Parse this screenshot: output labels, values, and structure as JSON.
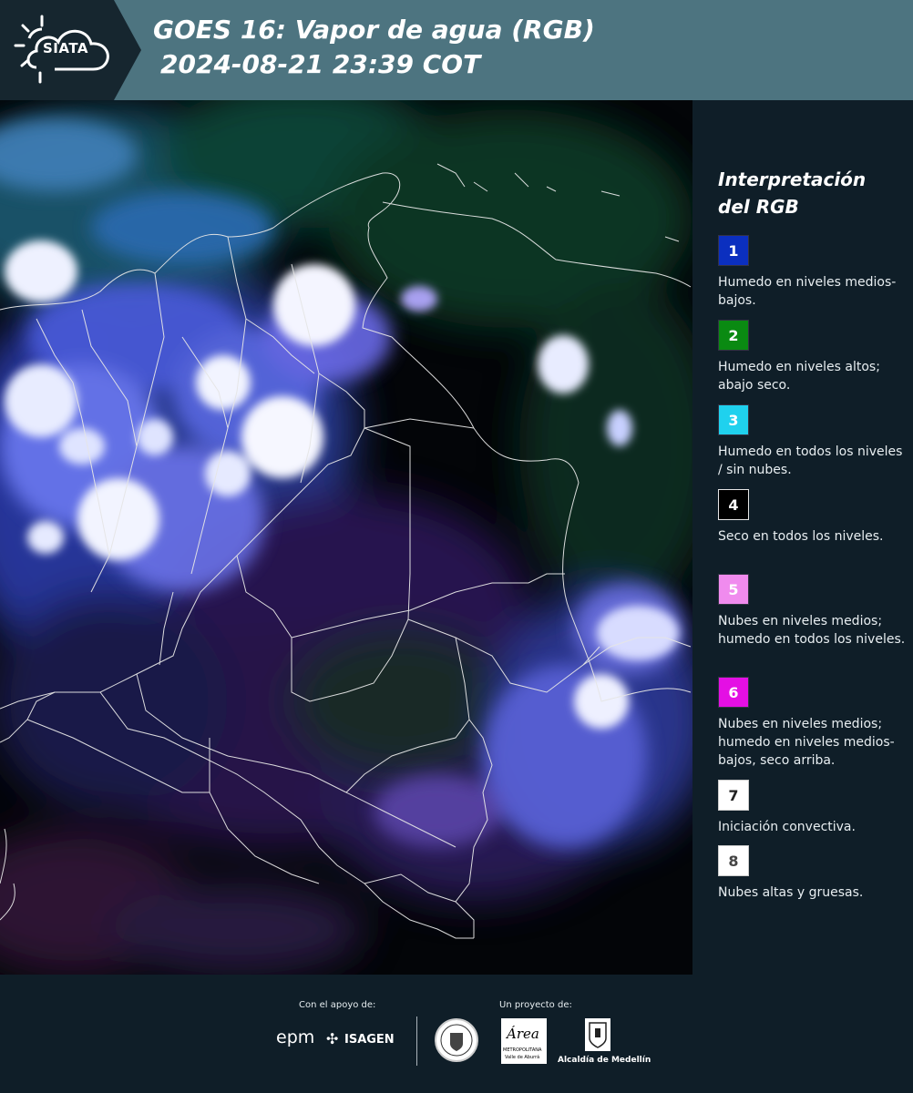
{
  "header": {
    "logo_text": "SIATA",
    "title_line1": "GOES 16: Vapor de agua (RGB)",
    "title_line2": "2024-08-21 23:39 COT"
  },
  "legend": {
    "title": "Interpretación del RGB",
    "items": [
      {
        "number": "1",
        "color": "#0b2fbf",
        "text_color": "#ffffff",
        "description": "Humedo en niveles medios-bajos."
      },
      {
        "number": "2",
        "color": "#0a8a12",
        "text_color": "#ffffff",
        "description": "Humedo en niveles altos; abajo seco."
      },
      {
        "number": "3",
        "color": "#1fd1ee",
        "text_color": "#ffffff",
        "description": "Humedo en todos los niveles / sin nubes."
      },
      {
        "number": "4",
        "color": "#000000",
        "text_color": "#ffffff",
        "description": "Seco en todos los niveles."
      },
      {
        "number": "5",
        "color": "#f08bee",
        "text_color": "#ffffff",
        "description": "Nubes en niveles medios; humedo en todos los niveles."
      },
      {
        "number": "6",
        "color": "#e40fe4",
        "text_color": "#ffffff",
        "description": "Nubes en niveles medios; humedo en niveles medios-bajos, seco arriba."
      },
      {
        "number": "7",
        "color": "#ffffff",
        "text_color": "#222222",
        "description": "Iniciación convectiva."
      },
      {
        "number": "8",
        "color": "#ffffff",
        "text_color": "#444444",
        "description": "Nubes altas y gruesas."
      }
    ]
  },
  "footer": {
    "support_label": "Con el apoyo de:",
    "project_label": "Un proyecto de:",
    "sponsor_epm": "epm",
    "sponsor_isagen": "ISAGEN",
    "area_metropolitana": "Área",
    "area_metropolitana_sub": "METROPOLITANA",
    "area_metropolitana_sub2": "Valle de Aburrá",
    "alcaldia": "Alcaldía de Medellín"
  }
}
